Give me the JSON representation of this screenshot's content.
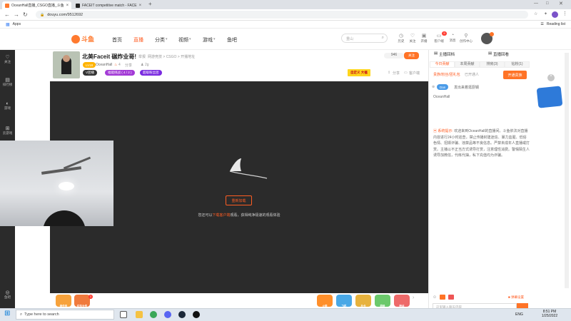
{
  "browser": {
    "tabs": [
      {
        "title": "OceanHall直播_CSGO直播_斗鱼",
        "close": "×"
      },
      {
        "title": "FACEIT competitive match - FACE",
        "close": "×"
      }
    ],
    "new_tab": "+",
    "url": "douyu.com/9512692",
    "bookmarks_label": "Apps",
    "reading_list": "Reading list"
  },
  "site": {
    "logo_text": "斗鱼",
    "nav": [
      "首页",
      "直播",
      "分类",
      "视频",
      "游戏",
      "鱼吧"
    ],
    "active_nav": "直播",
    "search_placeholder": "重山",
    "header_icons": [
      {
        "icon": "history-icon",
        "label": "历史"
      },
      {
        "icon": "follow-icon",
        "label": "关注"
      },
      {
        "icon": "live-icon",
        "label": "开播"
      },
      {
        "icon": "client-icon",
        "label": "客户端"
      },
      {
        "icon": "bell-icon",
        "label": "消息"
      },
      {
        "icon": "creator-icon",
        "label": "创作中心"
      }
    ],
    "header_badge": "9"
  },
  "sidebar": {
    "items": [
      {
        "icon": "heart-icon",
        "label": "关注"
      },
      {
        "icon": "list-icon",
        "label": "排行榜"
      },
      {
        "icon": "game-icon",
        "label": "游戏"
      },
      {
        "icon": "gamepad-icon",
        "label": "云游戏"
      },
      {
        "icon": "fish-icon",
        "label": "鱼吧"
      }
    ]
  },
  "room": {
    "title": "北美Faceit 碾炸业哥!",
    "report": "举报",
    "category_path": "网游竞技 > CSGO > 开播地址",
    "level_tag": "LV18",
    "streamer": "OceanHall",
    "heat": "4",
    "share_label": "分享",
    "followers": "2g",
    "vip_tag": "V团播",
    "badge1": "福能挑战 ( 4 / 2 )",
    "badge2": "超级粉丝团",
    "follow_count": "946",
    "follow_button": "关注",
    "screenshot_label": "分享",
    "client_label": "客户端",
    "download_banner": "自定义 大福"
  },
  "player": {
    "reload_button": "重新加载",
    "hint_prefix": "您还可以",
    "hint_link": "下载客户端",
    "hint_suffix": "观看，获得纯净极速的观看体验"
  },
  "gifts": {
    "left": [
      {
        "label": "做任务"
      },
      {
        "label": "红包大作"
      }
    ],
    "right": [
      {
        "label": "火箭"
      },
      {
        "label": "飞机"
      },
      {
        "label": "办卡"
      },
      {
        "label": "超级"
      },
      {
        "label": "粉丝"
      }
    ],
    "left_badge": "1"
  },
  "rightpanel": {
    "tab1": "主播回档",
    "tab2": "直播回看",
    "subtabs": [
      "今日贡献",
      "本周贡献",
      "排房(3)",
      "钻粉(1)"
    ],
    "rank_text": "贵族/粉丝/团礼包",
    "rank_suffix": "已开通人",
    "open_button": "开通贵族",
    "fan_tag": "Dan",
    "fan_text": "发出来着逛厨钢",
    "fan_user": "OceanHall",
    "system_label": "系统提示:",
    "system_msg": "欢迎来到OceanHall的直播间。斗鱼依法对直播内容进行24小时巡查，禁止传播封建迷信、暴力血腥、低俗色情、招嫖诈骗、违禁品等不良信息。严禁未成年人直播或打赏。主播以不正当方式诱导打赏，注意理性消费。警惕陌生人诱导加微信，代练代抽，私下充值均为诈骗。",
    "chat_placeholder": "这里输入聊天内容",
    "send_label": "发送"
  },
  "taskbar": {
    "search_placeholder": "Type here to search",
    "time": "8:51 PM",
    "date": "1/25/2022",
    "lang": "ENG"
  },
  "colors": {
    "accent": "#ff5d23",
    "player_bg": "#2b2b2b",
    "sidebar_bg": "#2b2b2b"
  }
}
